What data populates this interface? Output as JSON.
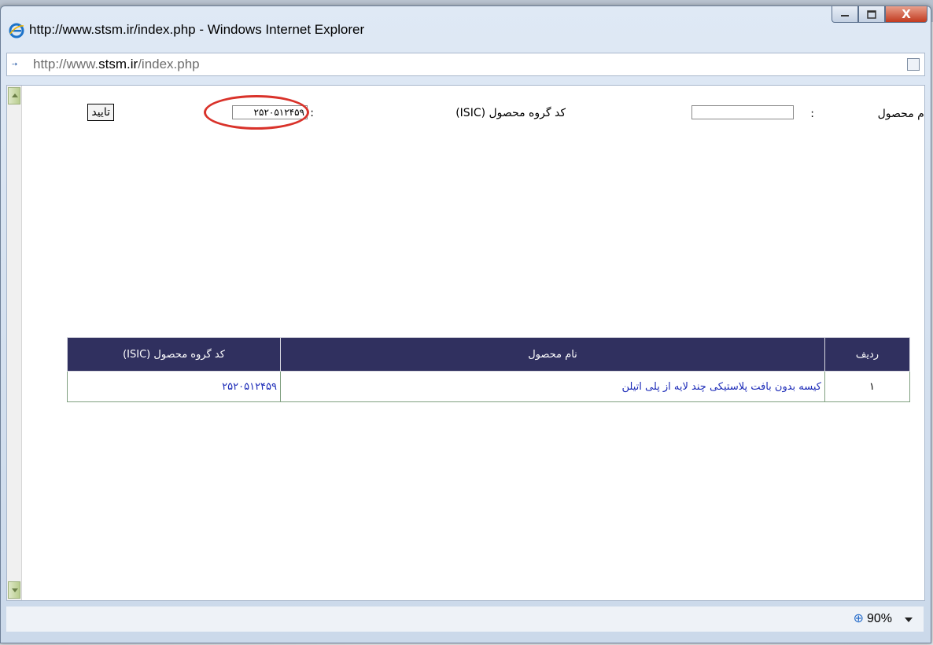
{
  "window": {
    "title": "http://www.stsm.ir/index.php - Windows Internet Explorer",
    "close_label": "X"
  },
  "address": {
    "prefix": "http://www.",
    "domain": "stsm.ir",
    "suffix": "/index.php"
  },
  "form": {
    "product_name_label": "نام محصول",
    "product_name_colon": ":",
    "product_name_value": "",
    "group_code_label": "کد گروه محصول (ISIC)",
    "group_code_colon": ":",
    "group_code_value": "۲۵۲۰۵۱۲۴۵۹",
    "confirm_label": "تایید"
  },
  "table": {
    "headers": [
      "ردیف",
      "نام محصول",
      "کد گروه محصول (ISIC)"
    ],
    "rows": [
      [
        "۱",
        "کیسه بدون بافت پلاستیکی چند لایه از پلی اتیلن",
        "۲۵۲۰۵۱۲۴۵۹"
      ]
    ]
  },
  "status": {
    "zoom": "90%"
  },
  "colors": {
    "table_header": "#30305f",
    "link_blue": "#1c2bb8",
    "highlight_circle": "#d9322a"
  }
}
